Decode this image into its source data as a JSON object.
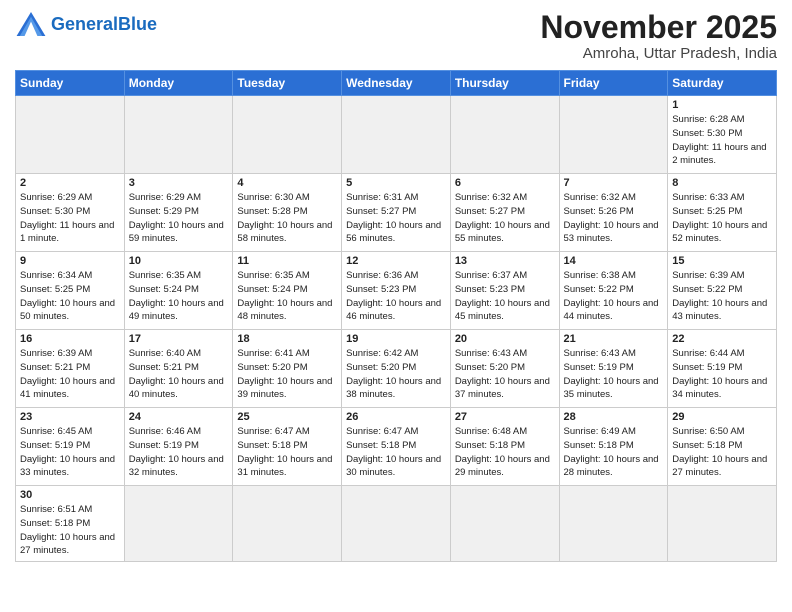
{
  "logo": {
    "general": "General",
    "blue": "Blue"
  },
  "title": "November 2025",
  "subtitle": "Amroha, Uttar Pradesh, India",
  "days_of_week": [
    "Sunday",
    "Monday",
    "Tuesday",
    "Wednesday",
    "Thursday",
    "Friday",
    "Saturday"
  ],
  "weeks": [
    [
      {
        "day": "",
        "info": ""
      },
      {
        "day": "",
        "info": ""
      },
      {
        "day": "",
        "info": ""
      },
      {
        "day": "",
        "info": ""
      },
      {
        "day": "",
        "info": ""
      },
      {
        "day": "",
        "info": ""
      },
      {
        "day": "1",
        "info": "Sunrise: 6:28 AM\nSunset: 5:30 PM\nDaylight: 11 hours and 2 minutes."
      }
    ],
    [
      {
        "day": "2",
        "info": "Sunrise: 6:29 AM\nSunset: 5:30 PM\nDaylight: 11 hours and 1 minute."
      },
      {
        "day": "3",
        "info": "Sunrise: 6:29 AM\nSunset: 5:29 PM\nDaylight: 10 hours and 59 minutes."
      },
      {
        "day": "4",
        "info": "Sunrise: 6:30 AM\nSunset: 5:28 PM\nDaylight: 10 hours and 58 minutes."
      },
      {
        "day": "5",
        "info": "Sunrise: 6:31 AM\nSunset: 5:27 PM\nDaylight: 10 hours and 56 minutes."
      },
      {
        "day": "6",
        "info": "Sunrise: 6:32 AM\nSunset: 5:27 PM\nDaylight: 10 hours and 55 minutes."
      },
      {
        "day": "7",
        "info": "Sunrise: 6:32 AM\nSunset: 5:26 PM\nDaylight: 10 hours and 53 minutes."
      },
      {
        "day": "8",
        "info": "Sunrise: 6:33 AM\nSunset: 5:25 PM\nDaylight: 10 hours and 52 minutes."
      }
    ],
    [
      {
        "day": "9",
        "info": "Sunrise: 6:34 AM\nSunset: 5:25 PM\nDaylight: 10 hours and 50 minutes."
      },
      {
        "day": "10",
        "info": "Sunrise: 6:35 AM\nSunset: 5:24 PM\nDaylight: 10 hours and 49 minutes."
      },
      {
        "day": "11",
        "info": "Sunrise: 6:35 AM\nSunset: 5:24 PM\nDaylight: 10 hours and 48 minutes."
      },
      {
        "day": "12",
        "info": "Sunrise: 6:36 AM\nSunset: 5:23 PM\nDaylight: 10 hours and 46 minutes."
      },
      {
        "day": "13",
        "info": "Sunrise: 6:37 AM\nSunset: 5:23 PM\nDaylight: 10 hours and 45 minutes."
      },
      {
        "day": "14",
        "info": "Sunrise: 6:38 AM\nSunset: 5:22 PM\nDaylight: 10 hours and 44 minutes."
      },
      {
        "day": "15",
        "info": "Sunrise: 6:39 AM\nSunset: 5:22 PM\nDaylight: 10 hours and 43 minutes."
      }
    ],
    [
      {
        "day": "16",
        "info": "Sunrise: 6:39 AM\nSunset: 5:21 PM\nDaylight: 10 hours and 41 minutes."
      },
      {
        "day": "17",
        "info": "Sunrise: 6:40 AM\nSunset: 5:21 PM\nDaylight: 10 hours and 40 minutes."
      },
      {
        "day": "18",
        "info": "Sunrise: 6:41 AM\nSunset: 5:20 PM\nDaylight: 10 hours and 39 minutes."
      },
      {
        "day": "19",
        "info": "Sunrise: 6:42 AM\nSunset: 5:20 PM\nDaylight: 10 hours and 38 minutes."
      },
      {
        "day": "20",
        "info": "Sunrise: 6:43 AM\nSunset: 5:20 PM\nDaylight: 10 hours and 37 minutes."
      },
      {
        "day": "21",
        "info": "Sunrise: 6:43 AM\nSunset: 5:19 PM\nDaylight: 10 hours and 35 minutes."
      },
      {
        "day": "22",
        "info": "Sunrise: 6:44 AM\nSunset: 5:19 PM\nDaylight: 10 hours and 34 minutes."
      }
    ],
    [
      {
        "day": "23",
        "info": "Sunrise: 6:45 AM\nSunset: 5:19 PM\nDaylight: 10 hours and 33 minutes."
      },
      {
        "day": "24",
        "info": "Sunrise: 6:46 AM\nSunset: 5:19 PM\nDaylight: 10 hours and 32 minutes."
      },
      {
        "day": "25",
        "info": "Sunrise: 6:47 AM\nSunset: 5:18 PM\nDaylight: 10 hours and 31 minutes."
      },
      {
        "day": "26",
        "info": "Sunrise: 6:47 AM\nSunset: 5:18 PM\nDaylight: 10 hours and 30 minutes."
      },
      {
        "day": "27",
        "info": "Sunrise: 6:48 AM\nSunset: 5:18 PM\nDaylight: 10 hours and 29 minutes."
      },
      {
        "day": "28",
        "info": "Sunrise: 6:49 AM\nSunset: 5:18 PM\nDaylight: 10 hours and 28 minutes."
      },
      {
        "day": "29",
        "info": "Sunrise: 6:50 AM\nSunset: 5:18 PM\nDaylight: 10 hours and 27 minutes."
      }
    ],
    [
      {
        "day": "30",
        "info": "Sunrise: 6:51 AM\nSunset: 5:18 PM\nDaylight: 10 hours and 27 minutes."
      },
      {
        "day": "",
        "info": ""
      },
      {
        "day": "",
        "info": ""
      },
      {
        "day": "",
        "info": ""
      },
      {
        "day": "",
        "info": ""
      },
      {
        "day": "",
        "info": ""
      },
      {
        "day": "",
        "info": ""
      }
    ]
  ]
}
